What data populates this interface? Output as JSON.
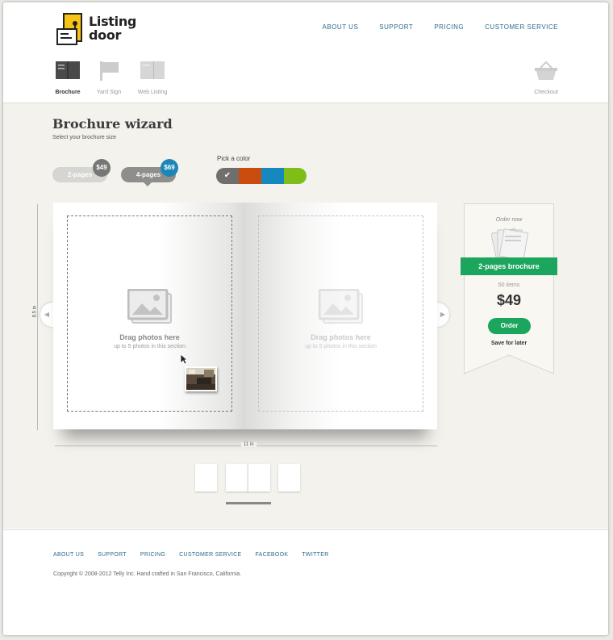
{
  "brand": {
    "name_line1": "Listing",
    "name_line2": "door",
    "logo_color": "#f6c316"
  },
  "topnav": [
    "ABOUT US",
    "SUPPORT",
    "PRICING",
    "CUSTOMER SERVICE"
  ],
  "products": {
    "brochure": "Brochure",
    "yard_sign": "Yard Sign",
    "web_listing": "Web Listing",
    "checkout": "Checkout",
    "active": "brochure"
  },
  "wizard": {
    "title": "Brochure wizard",
    "subtitle": "Select your brochure size",
    "sizes": [
      {
        "label": "2-pages",
        "price": "$49"
      },
      {
        "label": "4-pages",
        "price": "$69",
        "selected": true
      }
    ],
    "color_label": "Pick a color",
    "colors": [
      "#6f6f6d",
      "#cc4b0e",
      "#1788be",
      "#7fbd18"
    ],
    "selected_color_index": 0
  },
  "book": {
    "drop_title": "Drag photos here",
    "drop_sub": "up to 5 photos in this section",
    "height_label": "8.5 in",
    "width_label": "11 in"
  },
  "order": {
    "heading": "Order now",
    "ribbon": "2-pages brochure",
    "items": "50 items",
    "price": "$49",
    "button": "Order",
    "save": "Save for later",
    "accent": "#1ca55c"
  },
  "footer": {
    "links": [
      "ABOUT US",
      "SUPPORT",
      "PRICING",
      "CUSTOMER SERVICE",
      "FACEBOOK",
      "TWITTER"
    ],
    "copyright": "Copyright © 2008-2012 Telly Inc. Hand crafted in San Francisco, California."
  }
}
